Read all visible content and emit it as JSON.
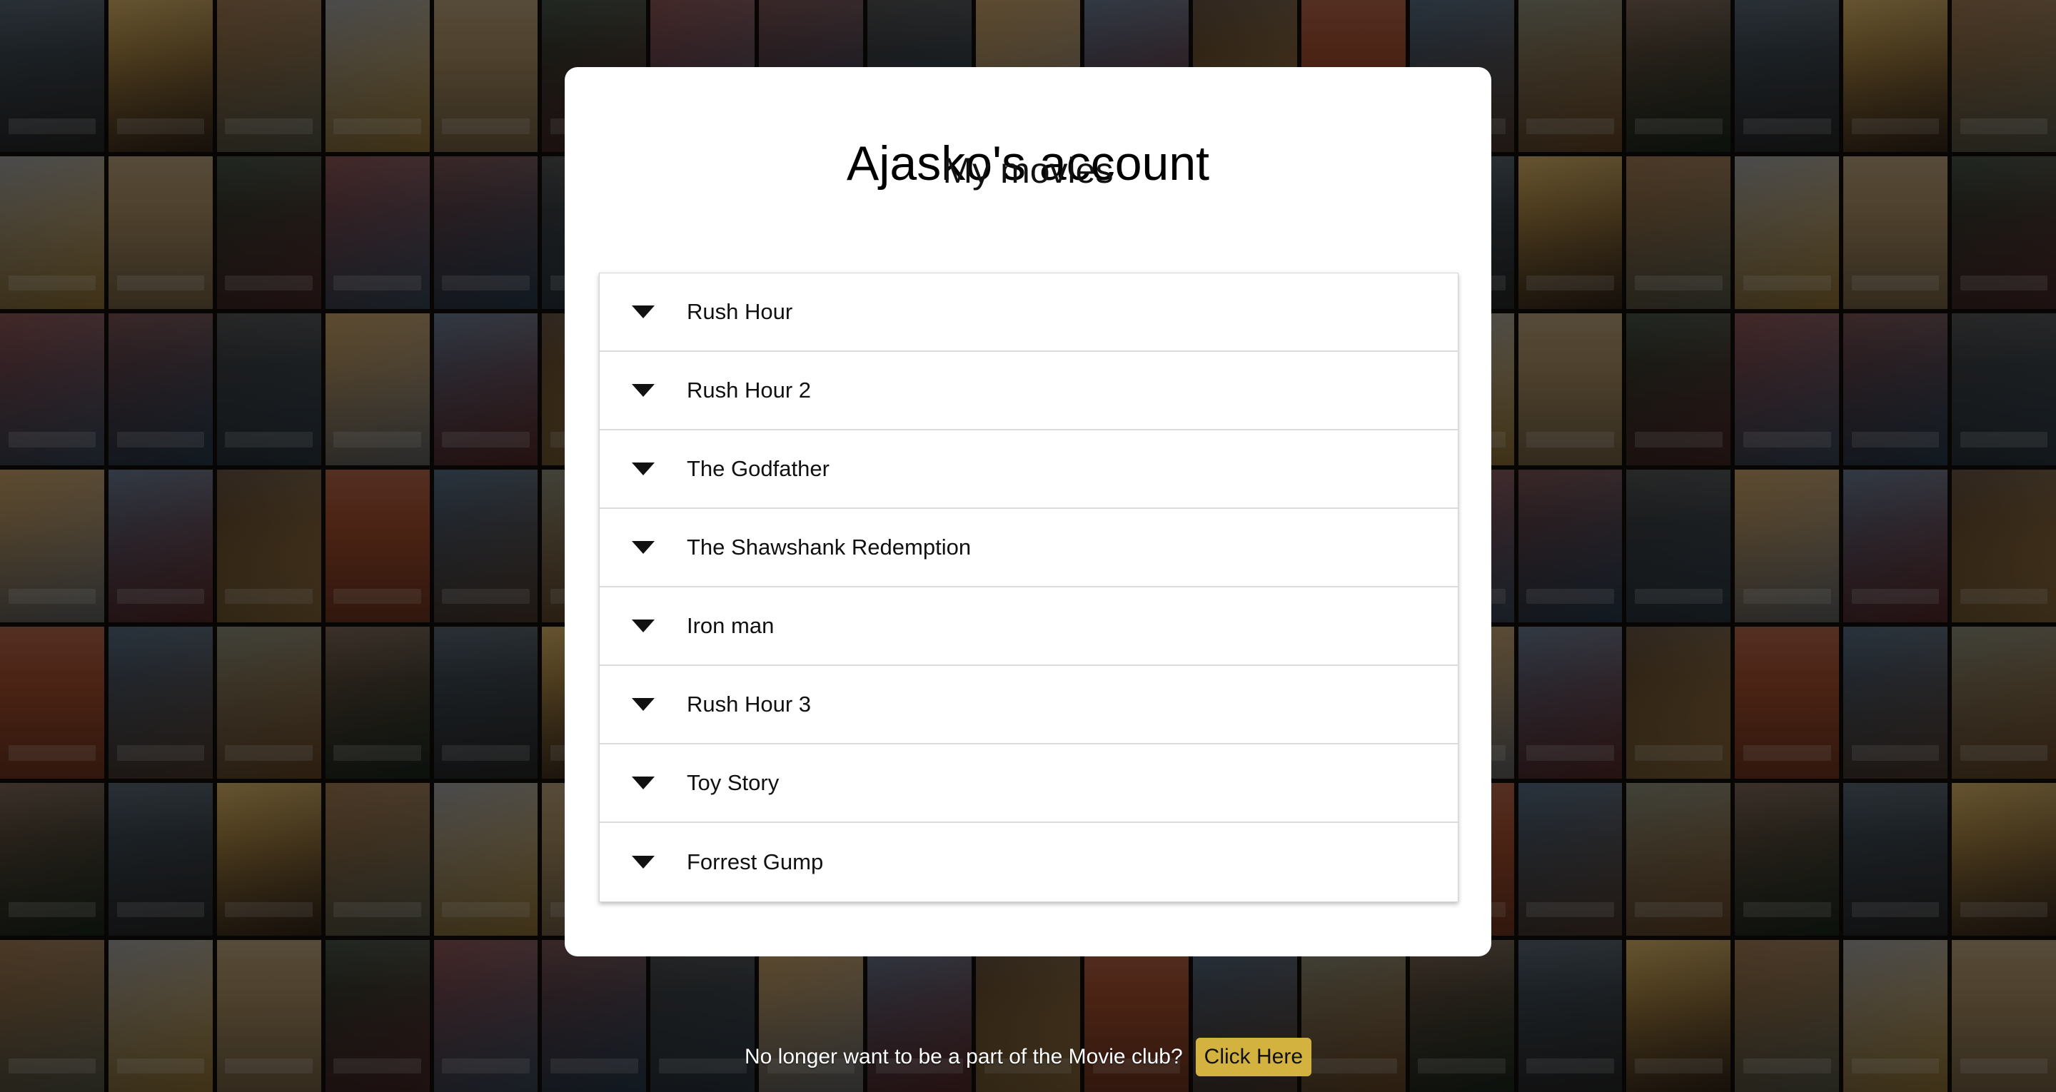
{
  "account": {
    "title": "Ajasko's account",
    "section_title": "My movies"
  },
  "movies": [
    {
      "title": "Rush Hour",
      "icon": "caret-down-icon"
    },
    {
      "title": "Rush Hour 2",
      "icon": "caret-down-icon"
    },
    {
      "title": "The Godfather",
      "icon": "caret-down-icon"
    },
    {
      "title": "The Shawshank Redemption",
      "icon": "caret-down-icon"
    },
    {
      "title": "Iron man",
      "icon": "caret-down-icon"
    },
    {
      "title": "Rush Hour 3",
      "icon": "caret-down-icon"
    },
    {
      "title": "Toy Story",
      "icon": "caret-down-icon"
    },
    {
      "title": "Forrest Gump",
      "icon": "caret-down-icon"
    }
  ],
  "footer": {
    "text": "No longer want to be a part of the Movie club?",
    "button_label": "Click Here"
  },
  "colors": {
    "button_background": "#d4b23f",
    "card_background": "#ffffff",
    "poster_palette": [
      "#3a2a1c",
      "#6b4a2a",
      "#8a6a3a",
      "#2e3a44",
      "#4a2a2a",
      "#5a5a4a",
      "#1f2a1f",
      "#7a3a22",
      "#6a6a6a",
      "#3c4a5c",
      "#9a7a3a",
      "#2a2a2a",
      "#4e3b2f",
      "#5b2c2c",
      "#2c3e50",
      "#7f6a4a"
    ]
  }
}
